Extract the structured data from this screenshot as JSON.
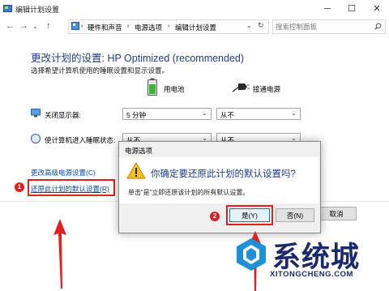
{
  "window": {
    "title": "编辑计划设置",
    "controls": {
      "minimize": "─",
      "maximize": "☐",
      "close": "✕"
    }
  },
  "nav": {
    "breadcrumbs": [
      "硬件和声音",
      "电源选项",
      "编辑计划设置"
    ],
    "separator": "›",
    "search_placeholder": "搜索控制面板"
  },
  "main": {
    "heading": "更改计划的设置: HP Optimized (recommended)",
    "subtext": "选择希望计算机使用的睡眠设置和显示设置。",
    "columns": {
      "battery": "用电池",
      "plugged": "接通电源"
    },
    "rows": [
      {
        "label": "关闭显示器:",
        "battery_value": "5 分钟",
        "plugged_value": "从不"
      },
      {
        "label": "使计算机进入睡眠状态:",
        "battery_value": "从不",
        "plugged_value": "从不"
      }
    ],
    "advanced_link": "更改高级电源设置(C)",
    "restore_link": "还原此计划的默认设置(R)",
    "cancel_button": "取消"
  },
  "dialog": {
    "title": "电源选项",
    "question": "你确定要还原此计划的默认设置吗?",
    "hint": "单击“是”立即还原该计划的所有默认设置。",
    "yes_button": "是(Y)",
    "no_button": "否(N)"
  },
  "annotations": {
    "badge1": "1",
    "badge2": "2"
  },
  "watermark": {
    "text": "系统城",
    "url": "XITONGCHENG.COM"
  },
  "colors": {
    "accent_red": "#e02020",
    "heading_blue": "#1e3b8b",
    "link_blue": "#0645ad"
  }
}
